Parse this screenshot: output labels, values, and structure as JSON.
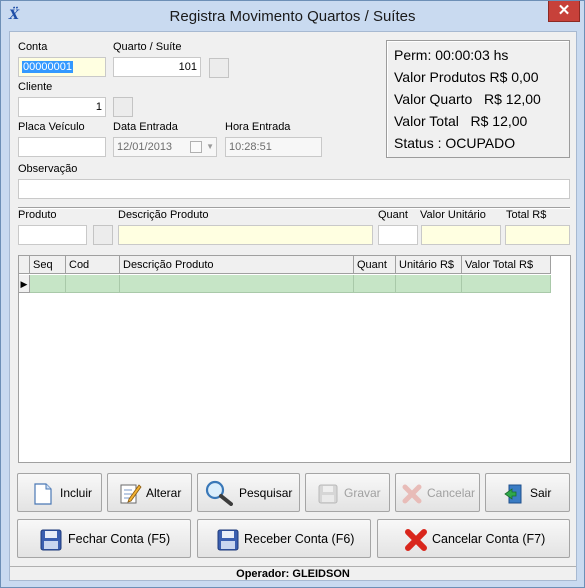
{
  "window": {
    "title": "Registra Movimento Quartos / Suítes",
    "close_glyph": "✕",
    "app_icon_glyph": "Ẍ"
  },
  "form": {
    "conta": {
      "label": "Conta",
      "value": "00000001"
    },
    "quarto": {
      "label": "Quarto / Suíte",
      "value": "101"
    },
    "cliente": {
      "label": "Cliente",
      "value": "1"
    },
    "placa": {
      "label": "Placa Veículo",
      "value": ""
    },
    "data_entrada": {
      "label": "Data Entrada",
      "value": "12/01/2013"
    },
    "hora_entrada": {
      "label": "Hora Entrada",
      "value": "10:28:51"
    },
    "observacao": {
      "label": "Observação",
      "value": ""
    }
  },
  "status": {
    "perm": "Perm: 00:00:03 hs",
    "valor_produtos": "Valor Produtos R$ 0,00",
    "valor_quarto": "Valor Quarto   R$ 12,00",
    "valor_total": "Valor Total   R$ 12,00",
    "status": "Status : OCUPADO"
  },
  "produto_entry": {
    "produto_label": "Produto",
    "descricao_label": "Descrição Produto",
    "quant_label": "Quant",
    "valor_unitario_label": "Valor Unitário",
    "total_label": "Total R$"
  },
  "grid": {
    "columns": [
      "Seq",
      "Cod",
      "Descrição Produto",
      "Quant",
      "Unitário R$",
      "Valor Total R$"
    ],
    "row_indicator": "▶"
  },
  "buttons": {
    "incluir": "Incluir",
    "alterar": "Alterar",
    "pesquisar": "Pesquisar",
    "gravar": "Gravar",
    "cancelar": "Cancelar",
    "sair": "Sair",
    "fechar_conta": "Fechar Conta (F5)",
    "receber_conta": "Receber Conta (F6)",
    "cancelar_conta": "Cancelar Conta (F7)"
  },
  "footer": {
    "operador": "Operador: GLEIDSON"
  },
  "colors": {
    "accent_blue": "#1f4fa8",
    "input_yellow": "#ffffe1",
    "grid_row_green": "#c6e5c6",
    "close_red": "#c7413a"
  }
}
